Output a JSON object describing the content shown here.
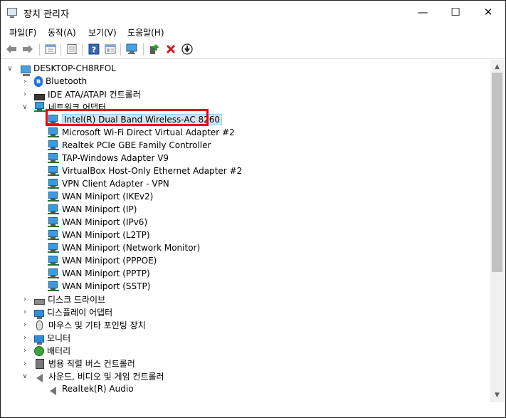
{
  "window": {
    "title": "장치 관리자",
    "minimize_glyph": "—",
    "maximize_glyph": "☐",
    "close_glyph": "✕"
  },
  "menu": [
    {
      "label": "파일(F)"
    },
    {
      "label": "동작(A)"
    },
    {
      "label": "보기(V)"
    },
    {
      "label": "도움말(H)"
    }
  ],
  "toolbar": {
    "icons": [
      "back-arrow-icon",
      "forward-arrow-icon",
      "properties-grid-icon",
      "properties-sheet-icon",
      "help-icon",
      "view-list-icon",
      "scan-hardware-icon",
      "update-driver-icon",
      "uninstall-icon",
      "disable-device-icon"
    ]
  },
  "tree": {
    "root": {
      "label": "DESKTOP-CH8RFOL",
      "expander": "∨",
      "icon": "computer-icon"
    },
    "categories": [
      {
        "label": "Bluetooth",
        "expander": "›",
        "icon": "bluetooth-icon"
      },
      {
        "label": "IDE ATA/ATAPI 컨트롤러",
        "expander": "›",
        "icon": "ide-controller-icon"
      },
      {
        "label": "네트워크 어댑터",
        "expander": "∨",
        "icon": "network-adapter-icon",
        "children": [
          "Intel(R) Dual Band Wireless-AC 8260",
          "Microsoft Wi-Fi Direct Virtual Adapter #2",
          "Realtek PCIe GBE Family Controller",
          "TAP-Windows Adapter V9",
          "VirtualBox Host-Only Ethernet Adapter #2",
          "VPN Client Adapter - VPN",
          "WAN Miniport (IKEv2)",
          "WAN Miniport (IP)",
          "WAN Miniport (IPv6)",
          "WAN Miniport (L2TP)",
          "WAN Miniport (Network Monitor)",
          "WAN Miniport (PPPOE)",
          "WAN Miniport (PPTP)",
          "WAN Miniport (SSTP)"
        ]
      },
      {
        "label": "디스크 드라이브",
        "expander": "›",
        "icon": "disk-drive-icon"
      },
      {
        "label": "디스플레이 어댑터",
        "expander": "›",
        "icon": "display-adapter-icon"
      },
      {
        "label": "마우스 및 기타 포인팅 장치",
        "expander": "›",
        "icon": "mouse-icon"
      },
      {
        "label": "모니터",
        "expander": "›",
        "icon": "monitor-icon"
      },
      {
        "label": "배터리",
        "expander": "›",
        "icon": "battery-icon"
      },
      {
        "label": "범용 직렬 버스 컨트롤러",
        "expander": "›",
        "icon": "usb-controller-icon"
      },
      {
        "label": "사운드, 비디오 및 게임 컨트롤러",
        "expander": "∨",
        "icon": "sound-icon",
        "children": [
          "Realtek(R) Audio"
        ]
      }
    ],
    "selected_item": "Intel(R) Dual Band Wireless-AC 8260",
    "highlight_color": "#e8000e"
  },
  "scrollbar": {
    "up_glyph": "▲",
    "down_glyph": "▼"
  }
}
